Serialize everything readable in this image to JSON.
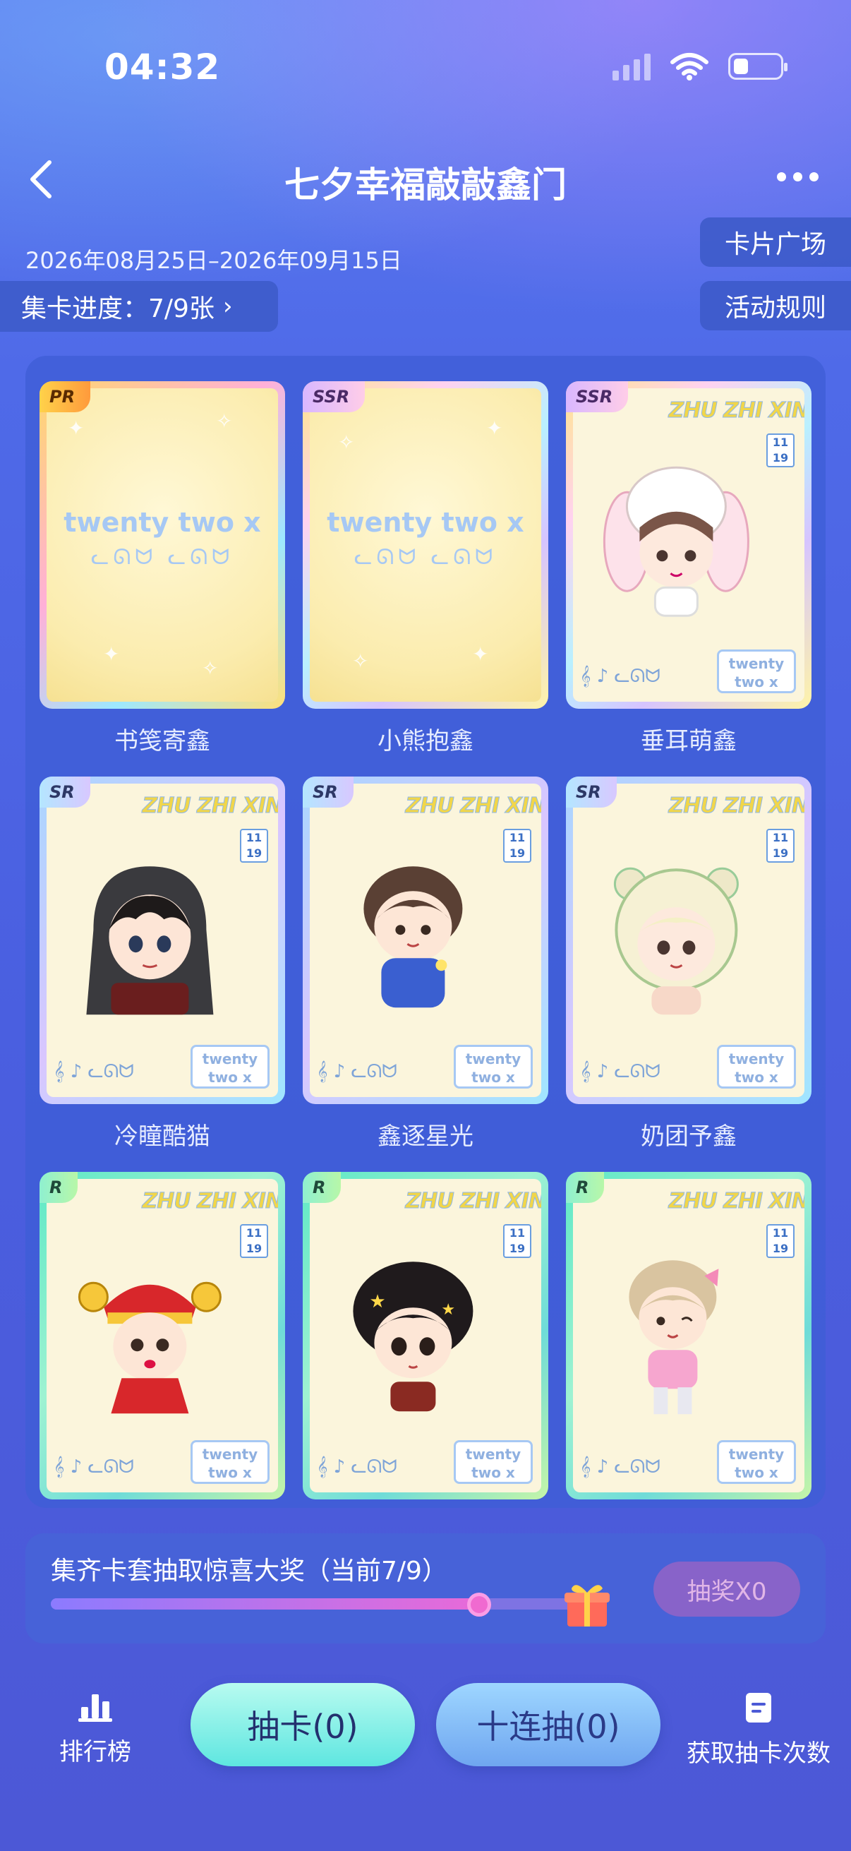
{
  "status_bar": {
    "time": "04:32"
  },
  "header": {
    "title": "七夕幸福敲敲鑫门",
    "date_range": "2026年08月25日–2026年09月15日",
    "progress_label": "集卡进度：7/9张",
    "card_plaza": "卡片广场",
    "rules": "活动规则"
  },
  "cards": [
    {
      "name": "书笺寄鑫",
      "rarity": "PR",
      "state": "back",
      "back_title": "twenty two x"
    },
    {
      "name": "小熊抱鑫",
      "rarity": "SSR",
      "state": "back",
      "back_title": "twenty two x"
    },
    {
      "name": "垂耳萌鑫",
      "rarity": "SSR",
      "state": "front",
      "brand": "ZHU ZHI XIN",
      "badge_top": "11",
      "badge_bottom": "19",
      "corner_top": "twenty",
      "corner_bottom": "two x"
    },
    {
      "name": "冷瞳酷猫",
      "rarity": "SR",
      "state": "front",
      "brand": "ZHU ZHI XIN",
      "badge_top": "11",
      "badge_bottom": "19",
      "corner_top": "twenty",
      "corner_bottom": "two x"
    },
    {
      "name": "鑫逐星光",
      "rarity": "SR",
      "state": "front",
      "brand": "ZHU ZHI XIN",
      "badge_top": "11",
      "badge_bottom": "19",
      "corner_top": "twenty",
      "corner_bottom": "two x"
    },
    {
      "name": "奶团予鑫",
      "rarity": "SR",
      "state": "front",
      "brand": "ZHU ZHI XIN",
      "badge_top": "11",
      "badge_bottom": "19",
      "corner_top": "twenty",
      "corner_bottom": "two x"
    },
    {
      "name": "",
      "rarity": "R",
      "state": "front",
      "brand": "ZHU ZHI XIN",
      "badge_top": "11",
      "badge_bottom": "19",
      "corner_top": "twenty",
      "corner_bottom": "two x"
    },
    {
      "name": "",
      "rarity": "R",
      "state": "front",
      "brand": "ZHU ZHI XIN",
      "badge_top": "11",
      "badge_bottom": "19",
      "corner_top": "twenty",
      "corner_bottom": "two x"
    },
    {
      "name": "",
      "rarity": "R",
      "state": "front",
      "brand": "ZHU ZHI XIN",
      "badge_top": "11",
      "badge_bottom": "19",
      "corner_top": "twenty",
      "corner_bottom": "two x"
    }
  ],
  "reward": {
    "text": "集齐卡套抽取惊喜大奖（当前7/9）",
    "progress_fraction": 0.778,
    "lottery_button": "抽奖X0"
  },
  "bottom_bar": {
    "ranking": "排行榜",
    "draw": "抽卡(0)",
    "ten_draw": "十连抽(0)",
    "earn_draws": "获取抽卡次数"
  },
  "icons": [
    "back-icon",
    "more-icon",
    "chevron-right-icon",
    "gift-icon",
    "ranking-icon",
    "document-icon",
    "wifi-icon",
    "battery-icon",
    "signal-icon"
  ],
  "colors": {
    "background": "#4f6ae8",
    "draw_button": "#5ee6e0",
    "ten_draw_button": "#6fa6f0",
    "progress_fill": "#e86ad8"
  }
}
